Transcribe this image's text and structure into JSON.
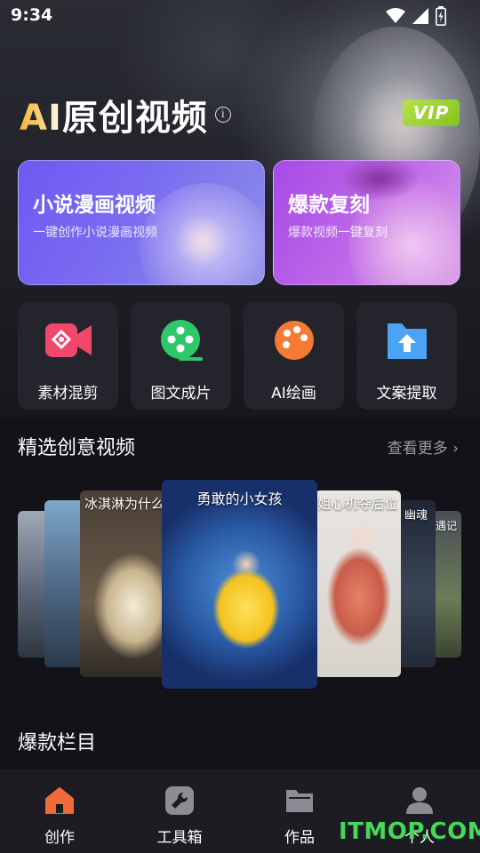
{
  "status_bar": {
    "time": "9:34"
  },
  "header": {
    "title": "AI原创视频",
    "info_icon": "info-icon",
    "vip_badge": "VIP"
  },
  "feature_cards": [
    {
      "title": "小说漫画视频",
      "subtitle": "一键创作小说漫画视频",
      "color": "#6d5af3"
    },
    {
      "title": "爆款复刻",
      "subtitle": "爆款视频一键复刻",
      "color": "#a64ae8"
    }
  ],
  "tools": [
    {
      "label": "素材混剪",
      "icon": "video-camera-icon",
      "color": "#f0476b"
    },
    {
      "label": "图文成片",
      "icon": "film-reel-icon",
      "color": "#2ec86a"
    },
    {
      "label": "AI绘画",
      "icon": "palette-icon",
      "color": "#f47a35"
    },
    {
      "label": "文案提取",
      "icon": "folder-upload-icon",
      "color": "#4aa3f5"
    }
  ],
  "featured": {
    "heading": "精选创意视频",
    "see_more": "查看更多",
    "slides": [
      {
        "caption": ""
      },
      {
        "caption": ""
      },
      {
        "caption": "冰淇淋为什么"
      },
      {
        "caption": "勇敢的小女孩"
      },
      {
        "caption": "姐心机夺后位"
      },
      {
        "caption": "幽魂"
      },
      {
        "caption": "遇记"
      }
    ]
  },
  "hot_section": {
    "heading": "爆款栏目"
  },
  "bottom_nav": [
    {
      "label": "创作",
      "icon": "home-icon",
      "active": true
    },
    {
      "label": "工具箱",
      "icon": "wrench-icon",
      "active": false
    },
    {
      "label": "作品",
      "icon": "folder-icon",
      "active": false
    },
    {
      "label": "个人",
      "icon": "person-icon",
      "active": false
    }
  ],
  "watermark": "ITMOP.COM",
  "colors": {
    "accent": "#f06a3a",
    "background": "#121218",
    "vip": "#9ad233",
    "watermark": "#46d85a"
  }
}
